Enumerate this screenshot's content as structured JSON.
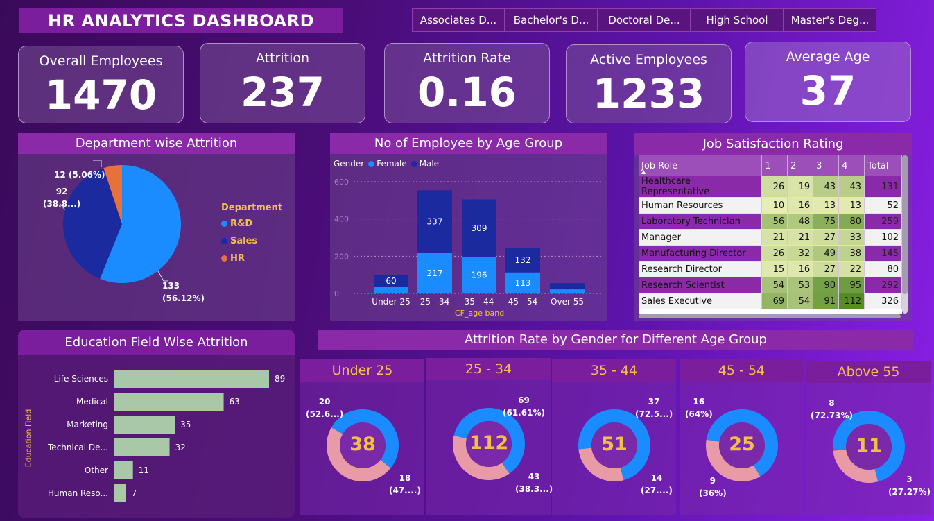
{
  "title": "HR ANALYTICS DASHBOARD",
  "slicers": [
    "Associates D...",
    "Bachelor's D...",
    "Doctoral De...",
    "High School",
    "Master's Deg..."
  ],
  "kpis": [
    {
      "label": "Overall Employees",
      "value": "1470"
    },
    {
      "label": "Attrition",
      "value": "237"
    },
    {
      "label": "Attrition Rate",
      "value": "0.16"
    },
    {
      "label": "Active Employees",
      "value": "1233"
    },
    {
      "label": "Average Age",
      "value": "37"
    }
  ],
  "dept_attrition": {
    "title": "Department wise Attrition",
    "legend_title": "Department",
    "legend": [
      {
        "name": "R&D",
        "color": "#1a8cff"
      },
      {
        "name": "Sales",
        "color": "#1b2a9e"
      },
      {
        "name": "HR",
        "color": "#e8703a"
      }
    ],
    "labels": {
      "rd_value": "133",
      "rd_pct": "(56.12%)",
      "sales_value": "92",
      "sales_pct": "(38.8...)",
      "hr": "12 (5.06%)"
    }
  },
  "age_group": {
    "title": "No of Employee by Age Group",
    "legend_title": "Gender",
    "legend_female": "Female",
    "legend_male": "Male",
    "xlabel": "CF_age band",
    "ytick_labels": [
      "600",
      "400",
      "200",
      "0"
    ],
    "categories": [
      "Under 25",
      "25 - 34",
      "35 - 44",
      "45 - 54",
      "Over 55"
    ]
  },
  "job_satisfaction": {
    "title": "Job Satisfaction Rating",
    "headers": [
      "Job Role",
      "1",
      "2",
      "3",
      "4",
      "Total"
    ],
    "rows": [
      {
        "role": "Healthcare Representative",
        "v": [
          "26",
          "19",
          "43",
          "43"
        ],
        "total": "131"
      },
      {
        "role": "Human Resources",
        "v": [
          "10",
          "16",
          "13",
          "13"
        ],
        "total": "52"
      },
      {
        "role": "Laboratory Technician",
        "v": [
          "56",
          "48",
          "75",
          "80"
        ],
        "total": "259"
      },
      {
        "role": "Manager",
        "v": [
          "21",
          "21",
          "27",
          "33"
        ],
        "total": "102"
      },
      {
        "role": "Manufacturing Director",
        "v": [
          "26",
          "32",
          "49",
          "38"
        ],
        "total": "145"
      },
      {
        "role": "Research Director",
        "v": [
          "15",
          "16",
          "27",
          "22"
        ],
        "total": "80"
      },
      {
        "role": "Research Scientist",
        "v": [
          "54",
          "53",
          "90",
          "95"
        ],
        "total": "292"
      },
      {
        "role": "Sales Executive",
        "v": [
          "69",
          "54",
          "91",
          "112"
        ],
        "total": "326"
      }
    ]
  },
  "education": {
    "title": "Education Field Wise Attrition",
    "ylabel": "Education Field"
  },
  "gender_section_title": "Attrition Rate by Gender for Different Age Group",
  "gender_groups": [
    {
      "title": "Under 25",
      "center": "38",
      "male_value": "20",
      "male_pct": "(52.6...)",
      "female_value": "18",
      "female_pct": "(47....)"
    },
    {
      "title": "25 - 34",
      "center": "112",
      "male_value": "69",
      "male_pct": "(61.61%)",
      "female_value": "43",
      "female_pct": "(38.3...)"
    },
    {
      "title": "35 - 44",
      "center": "51",
      "male_value": "37",
      "male_pct": "(72.5...)",
      "female_value": "14",
      "female_pct": "(27....)"
    },
    {
      "title": "45 - 54",
      "center": "25",
      "male_value": "16",
      "male_pct": "(64%)",
      "female_value": "9",
      "female_pct": "(36%)"
    },
    {
      "title": "Above 55",
      "center": "11",
      "male_value": "8",
      "male_pct": "(72.73%)",
      "female_value": "3",
      "female_pct": "(27.27%)"
    }
  ],
  "chart_data": [
    {
      "type": "pie",
      "title": "Department wise Attrition",
      "categories": [
        "R&D",
        "Sales",
        "HR"
      ],
      "values": [
        133,
        92,
        12
      ],
      "colors": [
        "#1a8cff",
        "#1b2a9e",
        "#e8703a"
      ],
      "legend": "right"
    },
    {
      "type": "bar",
      "title": "No of Employee by Age Group",
      "xlabel": "CF_age band",
      "categories": [
        "Under 25",
        "25 - 34",
        "35 - 44",
        "45 - 54",
        "Over 55"
      ],
      "series": [
        {
          "name": "Female",
          "values": [
            37,
            217,
            196,
            113,
            22
          ],
          "color": "#1a8cff"
        },
        {
          "name": "Male",
          "values": [
            60,
            337,
            309,
            132,
            33
          ],
          "color": "#1b2a9e"
        }
      ],
      "shown_labels": {
        "Female": [
          null,
          "217",
          "196",
          "113",
          null
        ],
        "Male": [
          "60",
          "337",
          "309",
          "132",
          null
        ]
      },
      "ylim": [
        0,
        600
      ],
      "stacked": true,
      "grid": true
    },
    {
      "type": "bar",
      "title": "Education Field Wise Attrition",
      "orientation": "horizontal",
      "ylabel": "Education Field",
      "categories": [
        "Life Sciences",
        "Medical",
        "Marketing",
        "Technical De...",
        "Other",
        "Human Reso..."
      ],
      "values": [
        89,
        63,
        35,
        32,
        11,
        7
      ],
      "color": "#a8c8a8"
    }
  ]
}
